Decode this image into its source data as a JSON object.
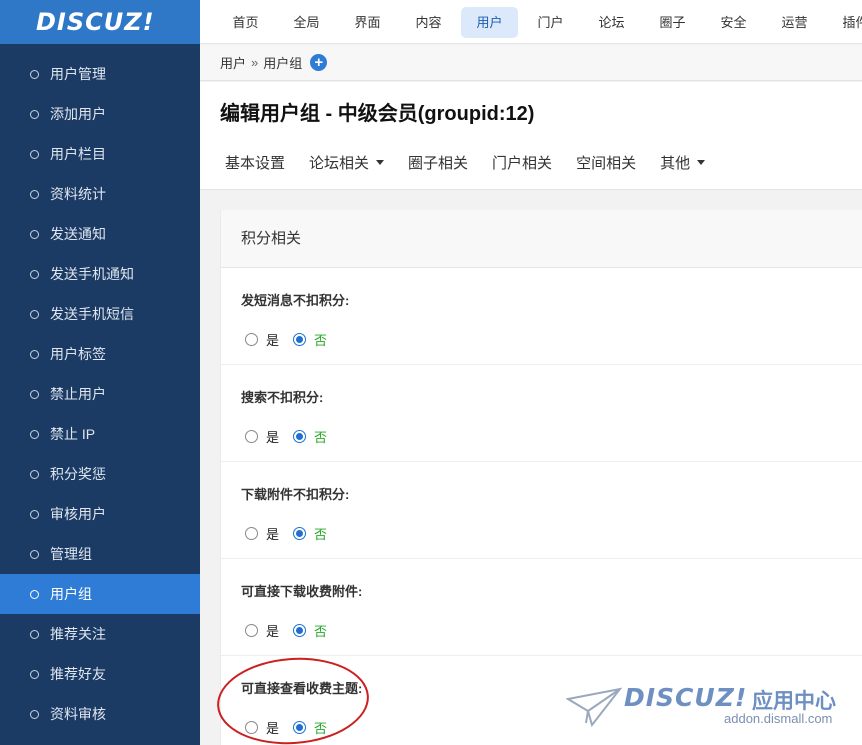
{
  "logo": "DISCUZ!",
  "sidebar": {
    "items": [
      {
        "label": "用户管理"
      },
      {
        "label": "添加用户"
      },
      {
        "label": "用户栏目"
      },
      {
        "label": "资料统计"
      },
      {
        "label": "发送通知"
      },
      {
        "label": "发送手机通知"
      },
      {
        "label": "发送手机短信"
      },
      {
        "label": "用户标签"
      },
      {
        "label": "禁止用户"
      },
      {
        "label": "禁止 IP"
      },
      {
        "label": "积分奖惩"
      },
      {
        "label": "审核用户"
      },
      {
        "label": "管理组"
      },
      {
        "label": "用户组",
        "active": true
      },
      {
        "label": "推荐关注"
      },
      {
        "label": "推荐好友"
      },
      {
        "label": "资料审核"
      }
    ]
  },
  "topnav": {
    "items": [
      "首页",
      "全局",
      "界面",
      "内容",
      "用户",
      "门户",
      "论坛",
      "圈子",
      "安全",
      "运营",
      "插件"
    ],
    "active_index": 4
  },
  "breadcrumb": {
    "root": "用户",
    "separator": "»",
    "current": "用户组"
  },
  "page": {
    "title": "编辑用户组 - 中级会员(groupid:12)"
  },
  "tabs": [
    {
      "label": "基本设置",
      "dropdown": false
    },
    {
      "label": "论坛相关",
      "dropdown": true
    },
    {
      "label": "圈子相关",
      "dropdown": false
    },
    {
      "label": "门户相关",
      "dropdown": false
    },
    {
      "label": "空间相关",
      "dropdown": false
    },
    {
      "label": "其他",
      "dropdown": true
    }
  ],
  "section": {
    "title": "积分相关"
  },
  "settings": [
    {
      "label": "发短消息不扣积分:",
      "yes": "是",
      "no": "否",
      "value": "no"
    },
    {
      "label": "搜索不扣积分:",
      "yes": "是",
      "no": "否",
      "value": "no"
    },
    {
      "label": "下载附件不扣积分:",
      "yes": "是",
      "no": "否",
      "value": "no"
    },
    {
      "label": "可直接下载收费附件:",
      "yes": "是",
      "no": "否",
      "value": "no"
    },
    {
      "label": "可直接查看收费主题:",
      "yes": "是",
      "no": "否",
      "value": "no"
    }
  ],
  "watermark": {
    "brand": "DISCUZ!",
    "cn": "应用中心",
    "url": "addon.dismall.com"
  },
  "colors": {
    "sidebar_bg": "#1b3b65",
    "accent": "#2e7cd5",
    "no_text": "#27a827",
    "annotation": "#cc1f1f"
  }
}
